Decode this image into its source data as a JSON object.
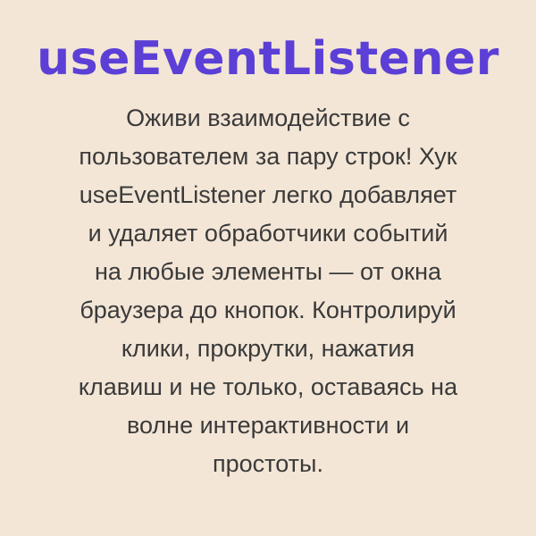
{
  "title": "useEventListener",
  "title_color": "#5b3fd6",
  "background_color": "#f3e6d6",
  "text_color": "#3a3a3a",
  "description_lines": [
    "Оживи взаимодействие с",
    "пользователем за пару строк! Хук",
    "useEventListener легко добавляет",
    "и удаляет обработчики событий",
    "на любые элементы — от окна",
    "браузера до кнопок. Контролируй",
    "клики, прокрутки, нажатия",
    "клавиш и не только, оставаясь на",
    "волне интерактивности и",
    "простоты."
  ]
}
